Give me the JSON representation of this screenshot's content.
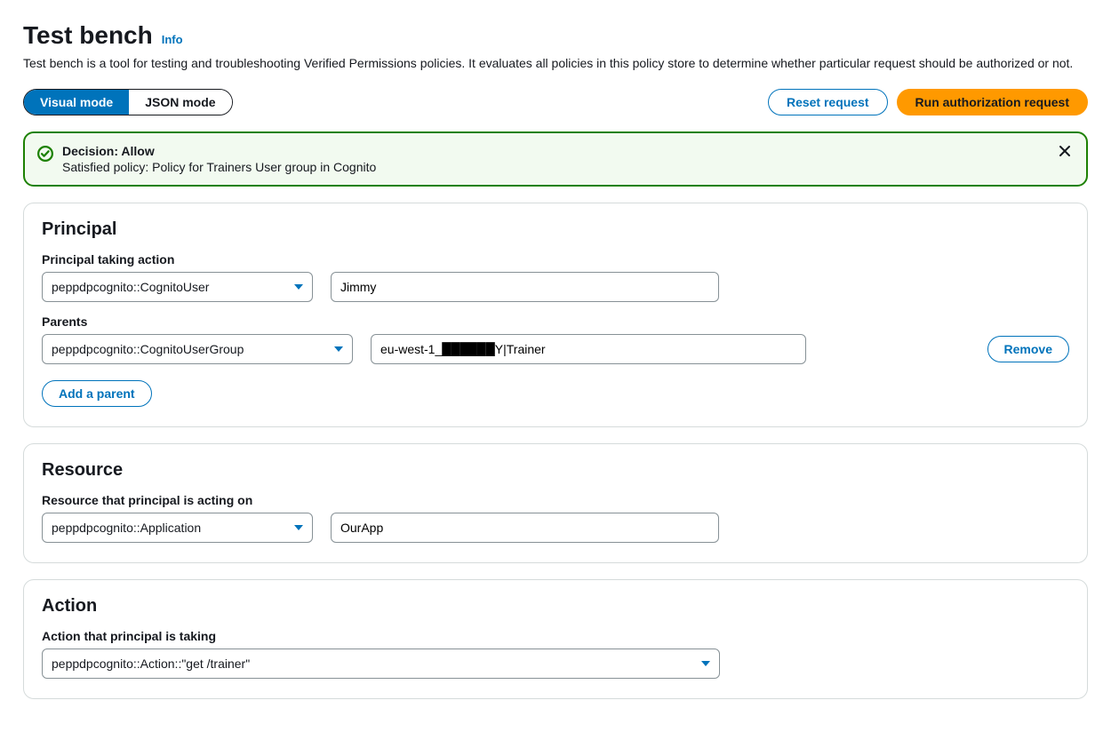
{
  "header": {
    "title": "Test bench",
    "info": "Info",
    "description": "Test bench is a tool for testing and troubleshooting Verified Permissions policies. It evaluates all policies in this policy store to determine whether particular request should be authorized or not."
  },
  "toolbar": {
    "visual_mode": "Visual mode",
    "json_mode": "JSON mode",
    "reset": "Reset request",
    "run": "Run authorization request"
  },
  "alert": {
    "decision": "Decision: Allow",
    "satisfied": "Satisfied policy: Policy for Trainers User group in Cognito"
  },
  "principal": {
    "heading": "Principal",
    "taking_action_label": "Principal taking action",
    "type_selected": "peppdpcognito::CognitoUser",
    "name_value": "Jimmy",
    "parents_label": "Parents",
    "parent_type_selected": "peppdpcognito::CognitoUserGroup",
    "parent_value": "eu-west-1_██████Y|Trainer",
    "remove": "Remove",
    "add_parent": "Add a parent"
  },
  "resource": {
    "heading": "Resource",
    "acting_on_label": "Resource that principal is acting on",
    "type_selected": "peppdpcognito::Application",
    "name_value": "OurApp"
  },
  "action": {
    "heading": "Action",
    "taking_label": "Action that principal is taking",
    "selected": "peppdpcognito::Action::\"get /trainer\""
  }
}
